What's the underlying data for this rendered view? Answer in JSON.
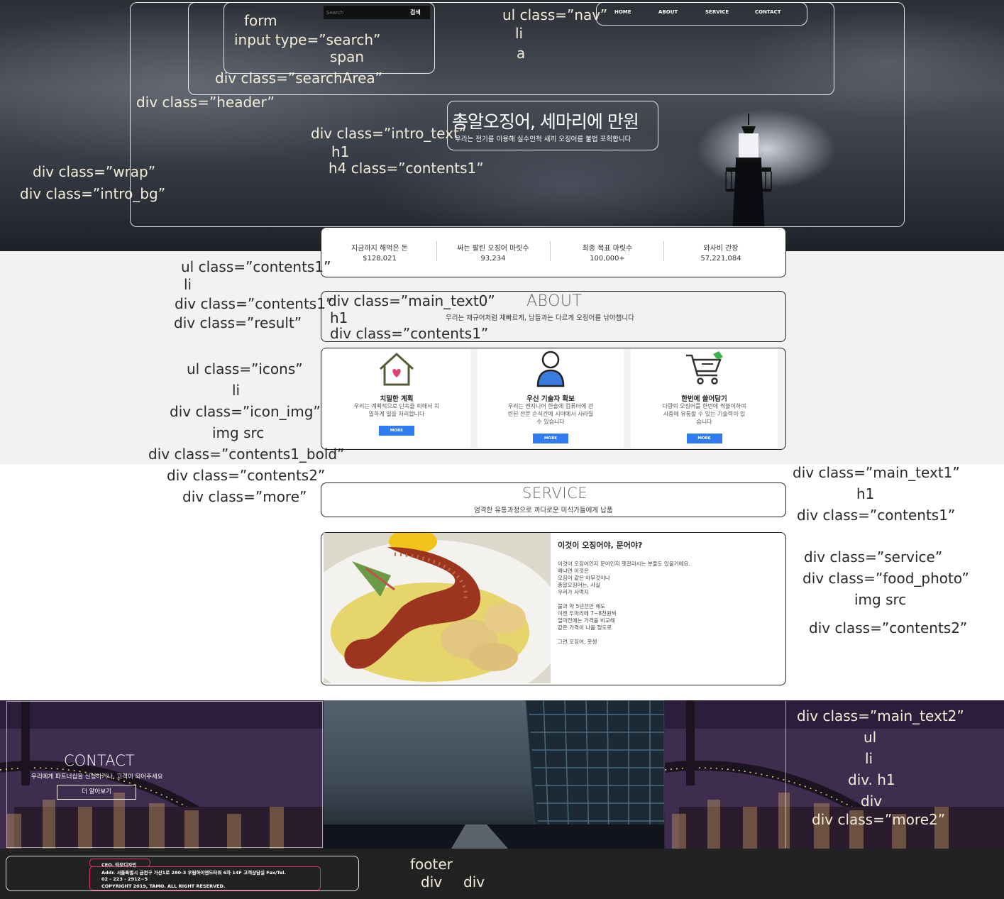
{
  "search": {
    "placeholder": "Search",
    "button_label": "검색"
  },
  "nav": {
    "items": [
      "HOME",
      "ABOUT",
      "SERVICE",
      "CONTACT"
    ]
  },
  "intro": {
    "title": "총알오징어, 세마리에 만원",
    "subtitle": "우리는 전기를 이용해 실수인척 새끼 오징어를 불법 포획합니다"
  },
  "result": [
    {
      "label": "지금까지 해먹은 돈",
      "value": "$128,021"
    },
    {
      "label": "싸는 팔린 오징어 마릿수",
      "value": "93,234"
    },
    {
      "label": "최종 목표 마릿수",
      "value": "100,000+"
    },
    {
      "label": "와사비 간장",
      "value": "57,221,084"
    }
  ],
  "about": {
    "title": "ABOUT",
    "subtitle": "우리는 재규어처럼 재빠르게, 남들과는 다르게 오징어를 낚아챕니다"
  },
  "icons": [
    {
      "icon": "house-heart-icon",
      "title": "치밀한 계획",
      "desc": "우리는 계획적으로 단속을 피해서 치밀하게 일을 처리합니다",
      "more": "MORE"
    },
    {
      "icon": "user-icon",
      "title": "우신 기술자 확보",
      "desc": "우리는 엔지니어 한솔에 컴퓨터에 관련된 전문 순식간에 시야에서 사라질 수 있습니다",
      "more": "MORE"
    },
    {
      "icon": "shopping-cart-icon",
      "title": "한번에 쓸어담기",
      "desc": "다량의 오징어를 한번에 싹쓸이하여 시중에 유통할 수 있는 기술력이 있습니다",
      "more": "MORE"
    }
  ],
  "service": {
    "title": "SERVICE",
    "subtitle": "엄격한 유통과정으로 까다로운 미식가들에게 납품",
    "food_title": "이것이 오징어야, 문어야?",
    "food_text": [
      "이것이 오징어인지 문어인지 헷갈리시는 분들도 있을거에요.",
      "왜냐면 이것은",
      "오징어 같은 아무것이나",
      "총알오징어는, 사실",
      "우리가 사먹지",
      "",
      "불과 약 5년전만 해도",
      "이젠 두마리에 7~8천원씩",
      "얼마전에는 가격을 비교해",
      "같은 가격이 나올 정도로",
      "",
      "그런 오징어, 못생"
    ]
  },
  "contact": {
    "title": "CONTACT",
    "subtitle": "우리에게 파트너십을 신청하거나, 고객이 되어주세요",
    "more": "더 알아보기"
  },
  "footer": {
    "ceo": "CEO. 타모디자인",
    "addr": "Addr. 서울특별시 금천구 가산1로 280-3 우림하이앤드타워 6차 14F 고객상담실 Fax/Tel.",
    "tel": "02 - 223 - 2912~5",
    "copy": "COPYRIGHT 2019, TAMO. ALL RIGHT RESERVED."
  },
  "annotations": {
    "form": "form",
    "input_search": "input type=”search”",
    "span": "span",
    "searchArea": "div class=”searchArea”",
    "header": "div class=”header”",
    "nav_ul": "ul class=”nav”",
    "nav_li": "li",
    "nav_a": "a",
    "intro_text": "div class=”intro_text”",
    "intro_h1": "h1",
    "intro_h4": "h4 class=”contents1”",
    "wrap": "div class=”wrap”",
    "intro_bg": "div class=”intro_bg”",
    "ul_contents1": "ul class=”contents1”",
    "ul_li": "li",
    "div_contents1": "div class=”contents1”",
    "result": "div class=”result”",
    "main_text0": "div class=”main_text0”",
    "main_text0_h1": "h1",
    "main_text0_contents1": "div class=”contents1”",
    "icons_ul": "ul class=”icons”",
    "icons_li": "li",
    "icon_img": "div class=”icon_img”",
    "img_src": "img src",
    "contents1_bold": "div class=”contents1_bold”",
    "contents2": "div class=”contents2”",
    "more": "div class=”more”",
    "main_text1": "div class=”main_text1”",
    "main_text1_h1": "h1",
    "main_text1_contents1": "div class=”contents1”",
    "service": "div class=”service”",
    "food_photo": "div class=”food_photo”",
    "food_img": "img src",
    "food_contents2": "div class=”contents2”",
    "main_text2": "div class=”main_text2”",
    "mt2_ul": "ul",
    "mt2_li": "li",
    "mt2_div_h1": "div. h1",
    "mt2_div": "div",
    "more2": "div class=”more2”",
    "footer": "footer",
    "footer_div1": "div",
    "footer_div2": "div"
  },
  "colors": {
    "accent_blue": "#2f7bf0",
    "annotation_cream": "#f3ecd8",
    "footer_bg": "#222222",
    "highlight_pink": "#e0316f"
  }
}
